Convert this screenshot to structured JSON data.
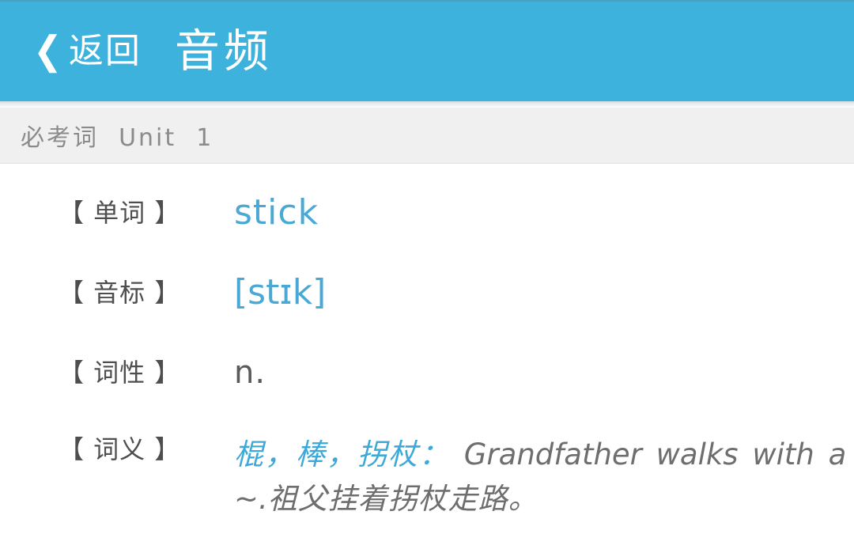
{
  "navbar": {
    "back_icon": "chevron-left-icon",
    "back_label": "返回",
    "title": "音频",
    "background_color": "#3cb2dc",
    "text_color": "#ffffff"
  },
  "subheader": {
    "text": "必考词  Unit  1",
    "background_color": "#f0f0f0",
    "text_color": "#8b8b8b"
  },
  "entry": {
    "rows": [
      {
        "label": "【 单词 】",
        "value": "stick",
        "value_color": "#4aa9d4"
      },
      {
        "label": "【 音标 】",
        "value": "[stɪk]",
        "value_color": "#4aa9d4"
      },
      {
        "label": "【 词性 】",
        "value": "n.",
        "value_color": "#5a5a5a"
      },
      {
        "label": "【 词义 】",
        "meaning_cn": "棍，棒，拐杖：",
        "meaning_en": " Grandfather walks with a ~.",
        "meaning_translation": "祖父挂着拐杖走路。",
        "cn_color": "#3ca9d8",
        "en_color": "#6e6e6e"
      }
    ]
  }
}
